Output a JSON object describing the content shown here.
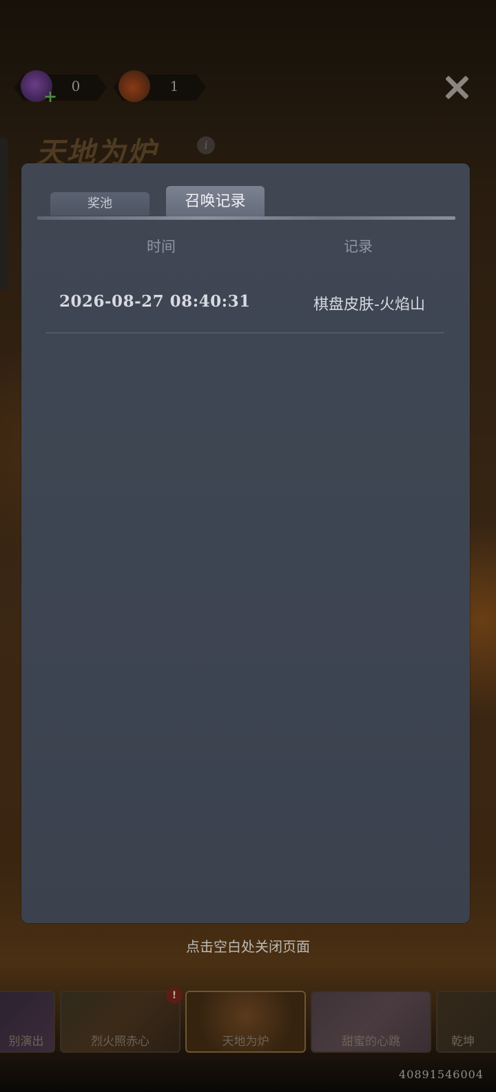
{
  "background": {
    "currencies": [
      {
        "icon": "candy-plus-icon",
        "value": "0"
      },
      {
        "icon": "flame-gem-icon",
        "value": "1"
      }
    ],
    "title": "天地为炉",
    "banners": [
      {
        "label": "别演出"
      },
      {
        "label": "烈火照赤心"
      },
      {
        "label": "天地为炉"
      },
      {
        "label": "甜蜜的心跳"
      },
      {
        "label": "乾坤"
      }
    ],
    "build_id": "40891546004"
  },
  "modal": {
    "tabs": [
      {
        "label": "奖池",
        "active": false
      },
      {
        "label": "召唤记录",
        "active": true
      }
    ],
    "columns": {
      "time": "时间",
      "record": "记录"
    },
    "rows": [
      {
        "time": "2026-08-27 08:40:31",
        "record": "棋盘皮肤-火焰山"
      }
    ]
  },
  "close_hint": "点击空白处关闭页面",
  "colors": {
    "modal_bg": "#3f4653",
    "active_tab": "#727988",
    "text": "#d7dae0",
    "header_text": "#8f96a3"
  }
}
